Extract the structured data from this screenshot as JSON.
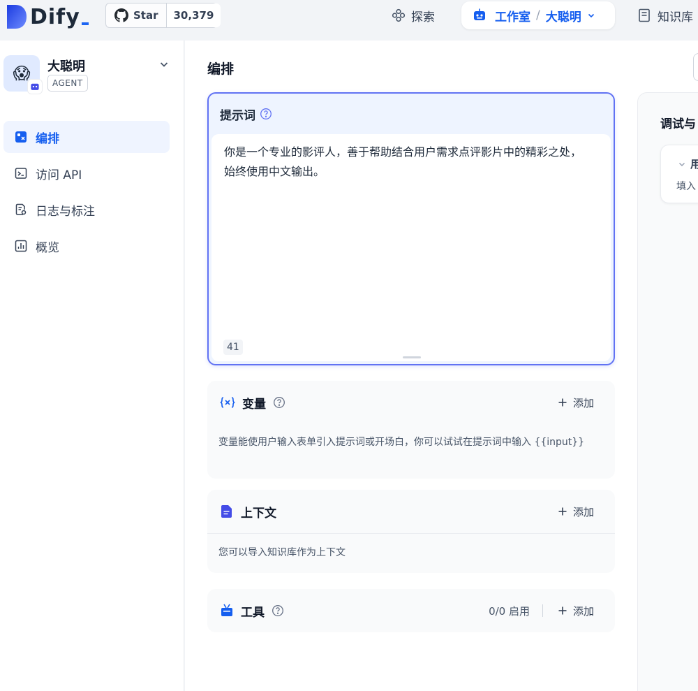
{
  "header": {
    "logo_text": "Dify",
    "github_star_label": "Star",
    "github_star_count": "30,379",
    "nav_explore": "探索",
    "nav_studio": "工作室",
    "nav_studio_separator": "/",
    "nav_studio_app": "大聪明",
    "nav_knowledge": "知识库"
  },
  "sidebar": {
    "app_emoji": "😱",
    "app_name": "大聪明",
    "app_mode": "AGENT",
    "items": [
      {
        "label": "编排",
        "icon": "orchestrate-icon",
        "active": true
      },
      {
        "label": "访问 API",
        "icon": "terminal-icon",
        "active": false
      },
      {
        "label": "日志与标注",
        "icon": "log-icon",
        "active": false
      },
      {
        "label": "概览",
        "icon": "chart-icon",
        "active": false
      }
    ]
  },
  "main": {
    "title": "编排",
    "prompt": {
      "title": "提示词",
      "text": "你是一个专业的影评人，善于帮助结合用户需求点评影片中的精彩之处，始终使用中文输出。",
      "char_count": "41"
    },
    "variables": {
      "title": "变量",
      "add_label": "添加",
      "description": "变量能使用户输入表单引入提示词或开场白，你可以试试在提示词中输入 {{input}}"
    },
    "context": {
      "title": "上下文",
      "add_label": "添加",
      "description": "您可以导入知识库作为上下文"
    },
    "tools": {
      "title": "工具",
      "status": "0/0 启用",
      "add_label": "添加"
    }
  },
  "debug": {
    "title": "调试与",
    "card_title": "用",
    "card_desc": "填入"
  },
  "colors": {
    "accent": "#155eef",
    "prompt_border": "#6172f3",
    "active_bg": "#eff4ff",
    "page_bg": "#f2f4f7"
  }
}
